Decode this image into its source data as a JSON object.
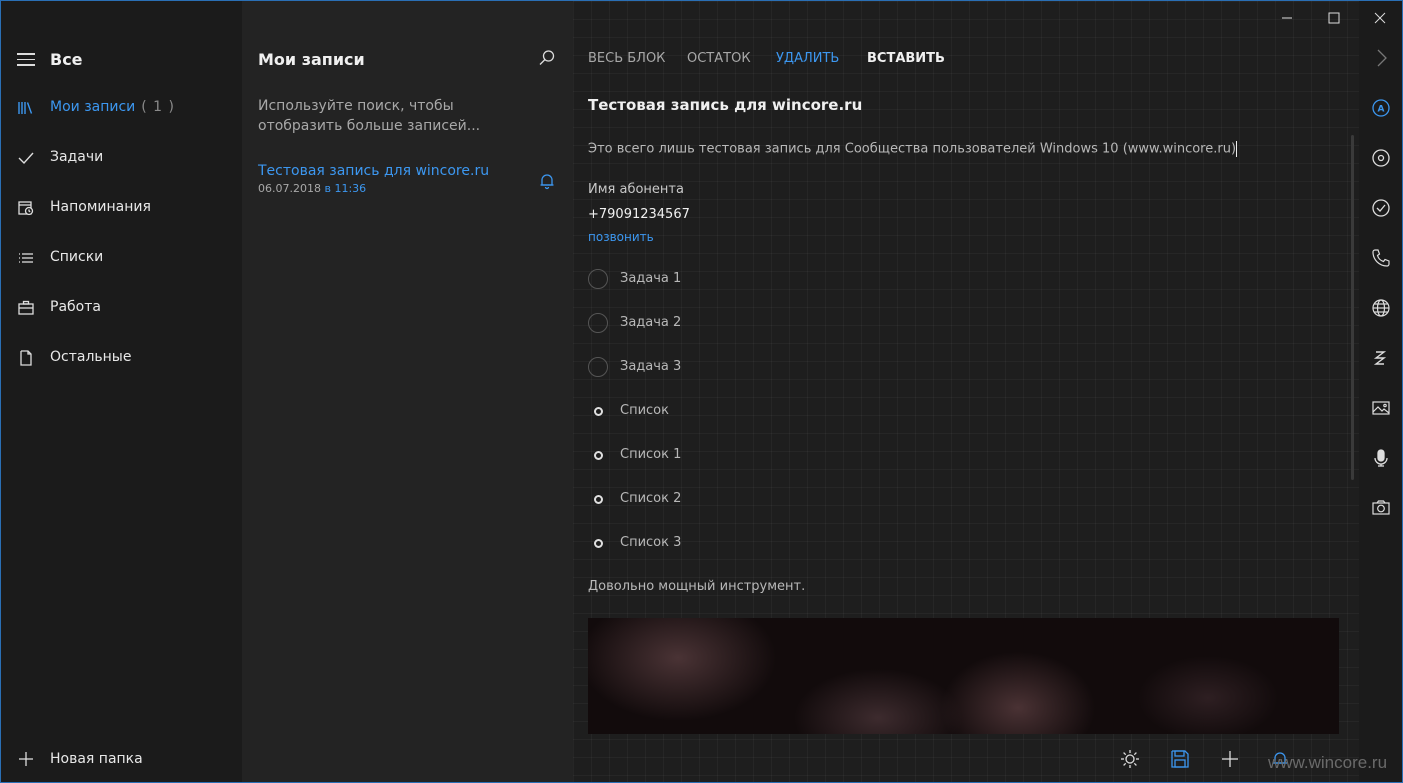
{
  "nav": {
    "title": "Все",
    "items": [
      {
        "label": "Мои записи",
        "count": "( 1 )",
        "icon": "library-icon",
        "active": true
      },
      {
        "label": "Задачи",
        "icon": "checkmark-icon"
      },
      {
        "label": "Напоминания",
        "icon": "calendar-reminder-icon"
      },
      {
        "label": "Списки",
        "icon": "list-icon"
      },
      {
        "label": "Работа",
        "icon": "briefcase-icon"
      },
      {
        "label": "Остальные",
        "icon": "document-icon"
      }
    ],
    "new_folder": "Новая папка"
  },
  "list": {
    "title": "Мои записи",
    "hint": "Используйте поиск, чтобы отобразить больше записей...",
    "entries": [
      {
        "title": "Тестовая запись для wincore.ru",
        "date": "06.07.2018",
        "time": "в 11:36"
      }
    ]
  },
  "toolbar": {
    "whole_block": "ВЕСЬ БЛОК",
    "remainder": "ОСТАТОК",
    "delete": "УДАЛИТЬ",
    "insert": "ВСТАВИТЬ"
  },
  "note": {
    "title": "Тестовая запись для wincore.ru",
    "body": "Это всего лишь тестовая запись для Сообщества пользователей Windows 10 (www.wincore.ru)",
    "contact_name": "Имя абонента",
    "contact_phone": "+79091234567",
    "contact_call": "позвонить",
    "tasks": [
      "Задача 1",
      "Задача 2",
      "Задача 3"
    ],
    "list_items": [
      "Список",
      "Список 1",
      "Список 2",
      "Список 3"
    ],
    "outro": "Довольно мощный инструмент."
  },
  "watermark": "www.wincore.ru",
  "colors": {
    "accent": "#3c97f0",
    "background": "#1c1c1c"
  }
}
